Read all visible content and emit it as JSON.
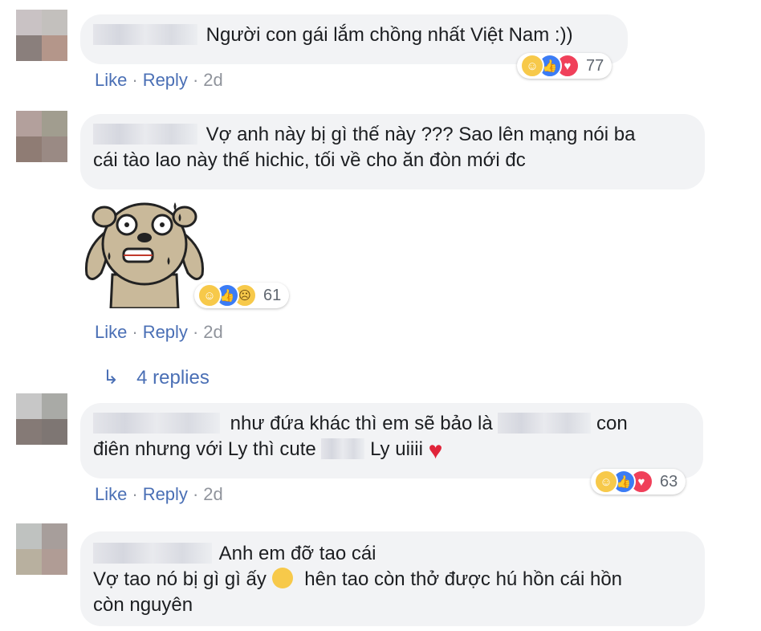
{
  "comments": [
    {
      "text": "Người con gái lắm chồng nhất Việt Nam :))",
      "reactions": {
        "icons": [
          "haha-icon",
          "like-icon",
          "love-icon"
        ],
        "count": "77"
      },
      "actions": {
        "like": "Like",
        "reply": "Reply",
        "time": "2d"
      }
    },
    {
      "text_line1": "Vợ anh này bị gì thế này ??? Sao lên mạng nói ba",
      "text_line2": "cái tào lao này thế hichic, tối về cho ăn đòn mới đc",
      "reactions": {
        "icons": [
          "haha-icon",
          "like-icon",
          "sad-icon"
        ],
        "count": "61"
      },
      "actions": {
        "like": "Like",
        "reply": "Reply",
        "time": "2d"
      },
      "replies_label": "4 replies"
    },
    {
      "text_part1": "như đứa khác thì em sẽ bảo là",
      "text_part2": "con",
      "text_line2a": "điên nhưng với Ly thì cute",
      "text_line2b": "Ly uiiii",
      "heart": "♥",
      "reactions": {
        "icons": [
          "haha-icon",
          "like-icon",
          "love-icon"
        ],
        "count": "63"
      },
      "actions": {
        "like": "Like",
        "reply": "Reply",
        "time": "2d"
      }
    },
    {
      "text_line1": "Anh em đỡ tao cái",
      "text_line2a": "Vợ tao nó bị gì gì ấy",
      "text_line2b": "hên tao còn thở được hú hồn cái hồn",
      "text_line3": "còn nguyên"
    }
  ],
  "colors": {
    "link": "#4a6fb5",
    "bubble": "#f2f3f5",
    "meta": "#90949c"
  }
}
